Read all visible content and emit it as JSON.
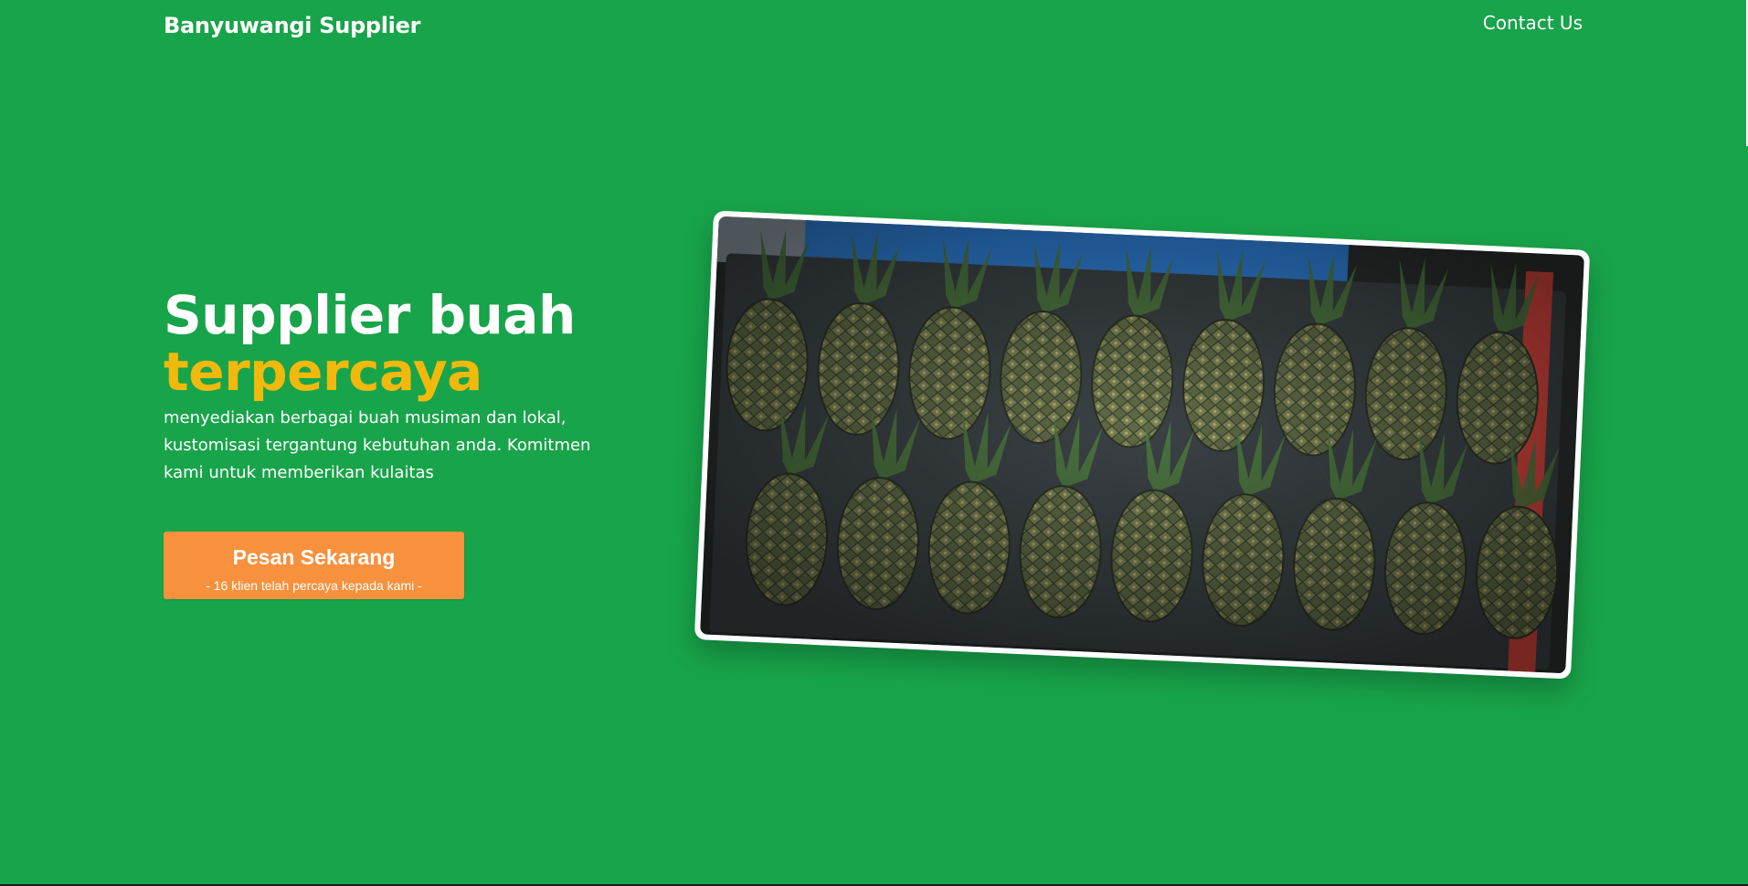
{
  "header": {
    "brand": "Banyuwangi Supplier",
    "nav_contact": "Contact Us"
  },
  "hero": {
    "title_line1": "Supplier buah",
    "title_accent": "terpercaya",
    "description": "menyediakan berbagai buah musiman dan lokal, kustomisasi tergantung kebutuhan anda. Komitmen kami untuk memberikan kulaitas",
    "cta": {
      "label": "Pesan Sekarang",
      "subtext": "- 16 klien telah percaya kepada kami -"
    },
    "image": {
      "subject": "pineapples-in-crates-photo"
    }
  },
  "colors": {
    "background": "#18a44a",
    "accent": "#f1b90c",
    "cta": "#f7913d",
    "text": "#ffffff"
  }
}
